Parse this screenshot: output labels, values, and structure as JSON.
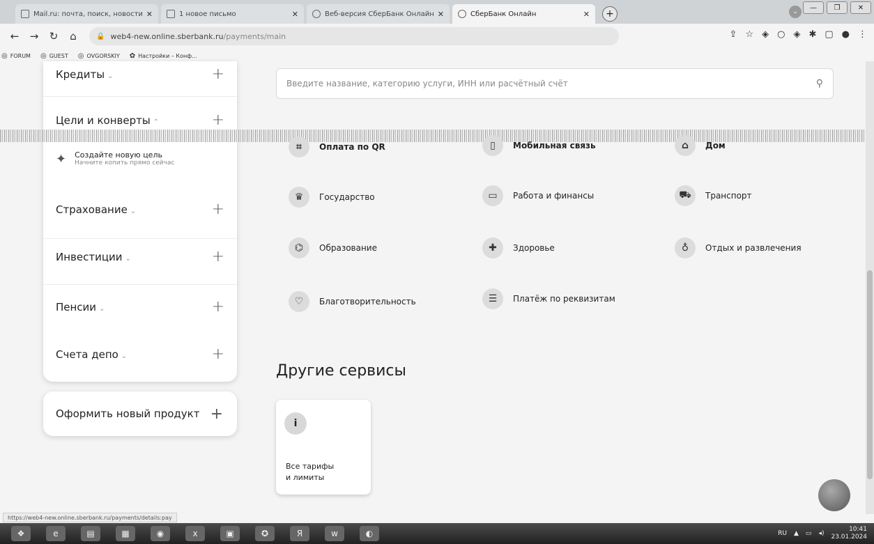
{
  "browser": {
    "tabs": [
      {
        "title": "Mail.ru: почта, поиск, новости",
        "active": false
      },
      {
        "title": "1 новое письмо",
        "active": false
      },
      {
        "title": "Веб-версия СберБанк Онлайн",
        "active": false
      },
      {
        "title": "СберБанк Онлайн",
        "active": true
      }
    ],
    "url_host": "web4-new.online.sberbank.ru",
    "url_path": "/payments/main",
    "bookmarks": [
      "FORUM",
      "GUEST",
      "OVGORSKIY",
      "Настройки – Конф..."
    ],
    "status_url": "https://web4-new.online.sberbank.ru/payments/details:pay"
  },
  "sidebar": {
    "items": [
      {
        "label": "Кредиты",
        "chevron": "⌄"
      },
      {
        "label": "Цели и конверты",
        "chevron": "⌃"
      },
      {
        "label": "Страхование",
        "chevron": "⌄"
      },
      {
        "label": "Инвестиции",
        "chevron": "⌄"
      },
      {
        "label": "Пенсии",
        "chevron": "⌄"
      },
      {
        "label": "Счета депо",
        "chevron": "⌄"
      }
    ],
    "goal": {
      "title": "Создайте новую цель",
      "subtitle": "Начните копить прямо сейчас"
    },
    "new_product": "Оформить новый продукт"
  },
  "search": {
    "placeholder": "Введите название, категорию услуги, ИНН или расчётный счёт"
  },
  "categories": [
    {
      "label": "Оплата по QR",
      "icon": "qr-icon"
    },
    {
      "label": "Мобильная связь",
      "icon": "phone-icon"
    },
    {
      "label": "Дом",
      "icon": "home-icon"
    },
    {
      "label": "Государство",
      "icon": "emblem-icon"
    },
    {
      "label": "Работа и финансы",
      "icon": "briefcase-icon"
    },
    {
      "label": "Транспорт",
      "icon": "car-icon"
    },
    {
      "label": "Образование",
      "icon": "graduation-cap-icon"
    },
    {
      "label": "Здоровье",
      "icon": "cross-icon"
    },
    {
      "label": "Отдых и развлечения",
      "icon": "balloon-icon"
    },
    {
      "label": "Благотворительность",
      "icon": "heart-hand-icon"
    },
    {
      "label": "Платёж по реквизитам",
      "icon": "document-icon"
    }
  ],
  "other_services": {
    "title": "Другие сервисы",
    "cards": [
      {
        "label_line1": "Все тарифы",
        "label_line2": "и лимиты",
        "icon": "info-icon"
      }
    ]
  },
  "taskbar": {
    "lang": "RU",
    "time": "10:41",
    "date": "23.01.2024"
  }
}
